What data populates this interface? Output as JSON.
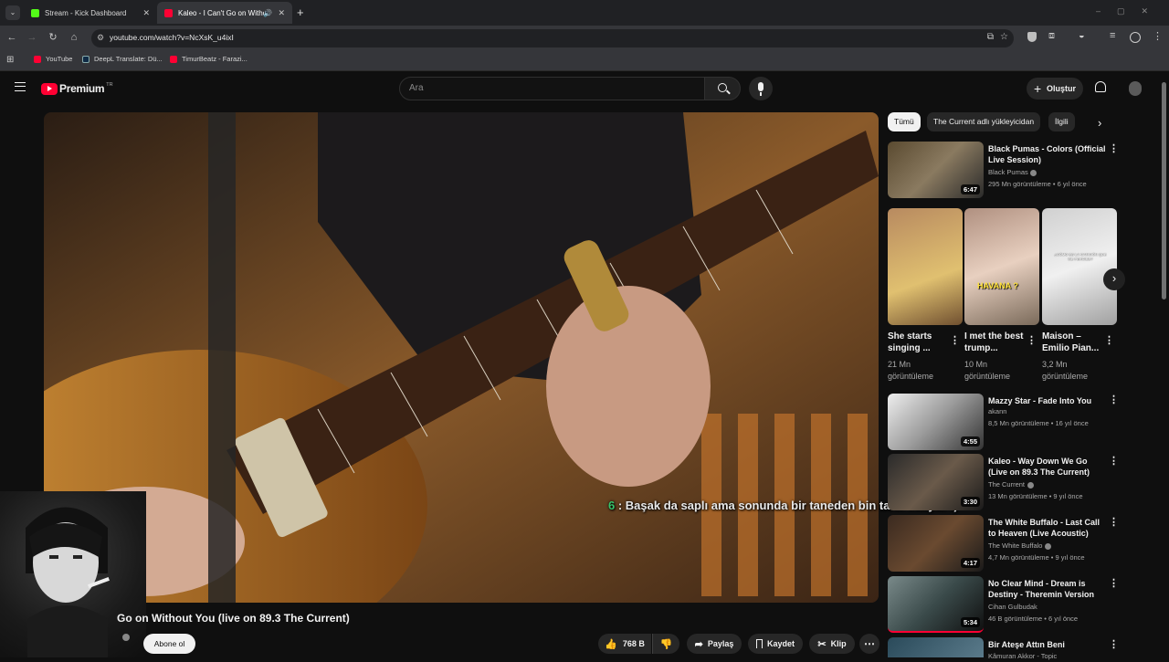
{
  "browser": {
    "tabs": [
      {
        "title": "Stream - Kick Dashboard",
        "icon_color": "#53fc18"
      },
      {
        "title": "Kaleo - I Can't Go on Witho",
        "icon_color": "#ff0033"
      }
    ],
    "url": "youtube.com/watch?v=NcXsK_u4ixI",
    "bookmarks": [
      {
        "label": "YouTube",
        "icon_color": "#ff0033"
      },
      {
        "label": "DeepL Translate: Dü...",
        "icon_color": "#0f2b46"
      },
      {
        "label": "TimurBeatz - Farazi...",
        "icon_color": "#ff0033"
      }
    ]
  },
  "header": {
    "logo_text": "Premium",
    "region": "TR",
    "search_placeholder": "Ara",
    "create_label": "Oluştur"
  },
  "player": {
    "caption_prefix": "6",
    "caption_text": " : Başak da saplı ama sonunda bir taneden bin tane veriyor :)"
  },
  "video": {
    "title": "Go on Without You (live on 89.3 The Current)",
    "subscribe_label": "Abone ol",
    "likes": "768 B",
    "share_label": "Paylaş",
    "save_label": "Kaydet",
    "clip_label": "Klip"
  },
  "filters": [
    "Tümü",
    "The Current adlı yükleyicidan",
    "İlgili"
  ],
  "recommendations": [
    {
      "title": "Black Pumas - Colors (Official Live Session)",
      "channel": "Black Pumas",
      "meta": "295 Mn görüntüleme • 6 yıl önce",
      "duration": "6:47"
    },
    {
      "title": "Mazzy Star -  Fade Into You",
      "channel": "akann",
      "meta": "8,5 Mn görüntüleme • 16 yıl önce",
      "duration": "4:55"
    },
    {
      "title": "Kaleo - Way Down We Go (Live on 89.3 The Current)",
      "channel": "The Current",
      "meta": "13 Mn görüntüleme • 9 yıl önce",
      "duration": "3:30"
    },
    {
      "title": "The White Buffalo - Last Call to Heaven (Live Acoustic)",
      "channel": "The White Buffalo",
      "meta": "4,7 Mn görüntüleme • 9 yıl önce",
      "duration": "4:17"
    },
    {
      "title": "No Clear Mind - Dream is Destiny - Theremin Version",
      "channel": "Cihan Gulbudak",
      "meta": "46 B görüntüleme • 6 yıl önce",
      "duration": "5:34"
    },
    {
      "title": "Bir Ateşe Attın Beni",
      "channel": "Kâmuran Akkor - Topic",
      "meta": "",
      "duration": ""
    }
  ],
  "shorts": [
    {
      "title": "She starts singing ...",
      "views": "21 Mn görüntüleme",
      "overlay": ""
    },
    {
      "title": "I met the best trump...",
      "views": "10 Mn görüntüleme",
      "overlay": "HAVANA ?"
    },
    {
      "title": "Maison – Emilio Pian...",
      "views": "3,2 Mn görüntüleme",
      "overlay": "¿CÓMO ES LA CANCIÓN QUE ME PERCIBE?"
    }
  ]
}
